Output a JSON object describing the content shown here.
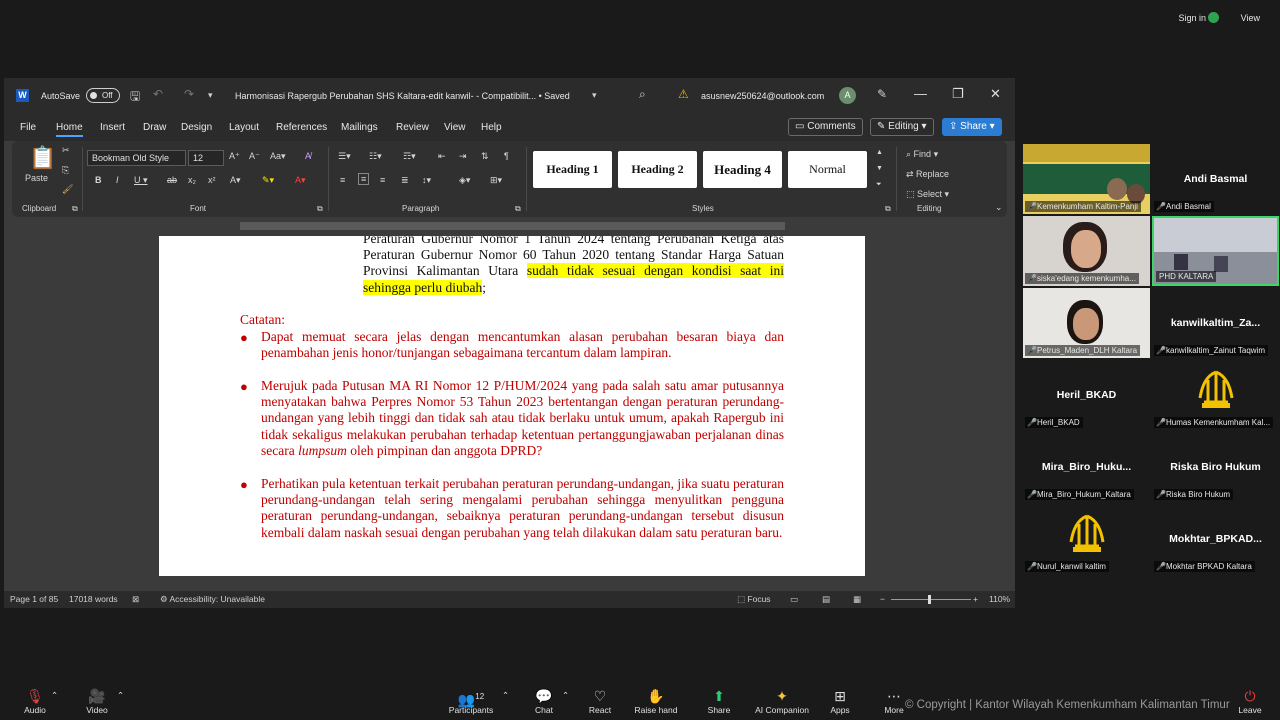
{
  "zoom_top": {
    "sign_in": "Sign in",
    "view": "View"
  },
  "word": {
    "logo": "W",
    "autosave": "AutoSave",
    "toggle": "Off",
    "doc_title": "Harmonisasi Rapergub Perubahan SHS Kaltara-edit kanwil-  -  Compatibilit...  •  Saved",
    "account": "asusnew250624@outlook.com",
    "avatar_letter": "A",
    "menu": [
      "File",
      "Home",
      "Insert",
      "Draw",
      "Design",
      "Layout",
      "References",
      "Mailings",
      "Review",
      "View",
      "Help"
    ],
    "comments": "Comments",
    "editing": "Editing",
    "share": "Share",
    "ribbon": {
      "paste": "Paste",
      "clipboard": "Clipboard",
      "font_name": "Bookman Old Style",
      "font_size": "12",
      "font": "Font",
      "paragraph": "Paragraph",
      "styles": [
        "Heading 1",
        "Heading 2",
        "Heading 4",
        "Normal"
      ],
      "styles_label": "Styles",
      "find": "Find",
      "replace": "Replace",
      "select": "Select",
      "editing_label": "Editing"
    },
    "doc": {
      "para1_a": "Peraturan Gubernur Nomor 1 Tahun 2024 tentang Perubahan Ketiga atas Peraturan Gubernur Nomor 60 Tahun 2020 tentang Standar Harga Satuan Provinsi Kalimantan Utara ",
      "para1_hl": "sudah tidak sesuai dengan kondisi saat ini sehingga perlu diubah",
      "para1_end": ";",
      "catatan": "Catatan:",
      "b1": "Dapat memuat secara jelas dengan mencantumkan alasan perubahan besaran biaya dan penambahan jenis honor/tunjangan sebagaimana tercantum dalam lampiran.",
      "b2_a": "Merujuk pada Putusan MA RI Nomor 12 P/HUM/2024 yang pada salah satu amar putusannya menyatakan bahwa Perpres Nomor 53 Tahun 2023 bertentangan dengan peraturan perundang-undangan yang lebih tinggi dan tidak sah atau tidak berlaku untuk umum, apakah Rapergub ini tidak sekaligus melakukan perubahan terhadap ketentuan pertanggungjawaban perjalanan dinas secara ",
      "b2_it": "lumpsum",
      "b2_b": " oleh pimpinan dan anggota DPRD?",
      "b3": "Perhatikan pula ketentuan terkait perubahan peraturan perundang-undangan, jika suatu peraturan perundang-undangan telah sering mengalami perubahan sehingga menyulitkan pengguna peraturan perundang-undangan, sebaiknya peraturan perundang-undangan tersebut disusun kembali dalam naskah sesuai dengan perubahan yang telah dilakukan dalam satu peraturan baru."
    },
    "status": {
      "page": "Page 1 of 85",
      "words": "17018 words",
      "access": "Accessibility: Unavailable",
      "focus": "Focus",
      "zoom": "110%"
    }
  },
  "participants": [
    {
      "name": "",
      "label": "Kemenkumham Kaltim-Panji",
      "kind": "video-banner"
    },
    {
      "name": "Andi Basmal",
      "label": "Andi Basmal",
      "kind": "name"
    },
    {
      "name": "",
      "label": "siska'edang kemenkumha...",
      "kind": "video-person"
    },
    {
      "name": "",
      "label": "PHD KALTARA",
      "kind": "video-room"
    },
    {
      "name": "",
      "label": "Petrus_Maden_DLH Kaltara",
      "kind": "video-person2"
    },
    {
      "name": "kanwilkaltim_Za...",
      "label": "kanwilkaltim_Zainut Taqwim",
      "kind": "name"
    },
    {
      "name": "Heril_BKAD",
      "label": "Heril_BKAD",
      "kind": "name"
    },
    {
      "name": "",
      "label": "Humas Kemenkumham Kal...",
      "kind": "emblem"
    },
    {
      "name": "Mira_Biro_Huku...",
      "label": "Mira_Biro_Hukum_Kaltara",
      "kind": "name"
    },
    {
      "name": "Riska Biro Hukum",
      "label": "Riska Biro Hukum",
      "kind": "name"
    },
    {
      "name": "",
      "label": "Nurul_kanwil kaltim",
      "kind": "emblem"
    },
    {
      "name": "Mokhtar_BPKAD...",
      "label": "Mokhtar BPKAD Kaltara",
      "kind": "name"
    }
  ],
  "zoom_bottom": {
    "items": [
      "Audio",
      "Video",
      "Participants",
      "Chat",
      "React",
      "Raise hand",
      "Share",
      "AI Companion",
      "Apps",
      "More",
      "Leave"
    ],
    "participant_count": "12",
    "copyright": "© Copyright | Kantor Wilayah Kemenkumham Kalimantan Timur"
  },
  "colors": {
    "accent": "#2b7cd3",
    "highlight": "#ffff00",
    "note_red": "#c00000"
  }
}
